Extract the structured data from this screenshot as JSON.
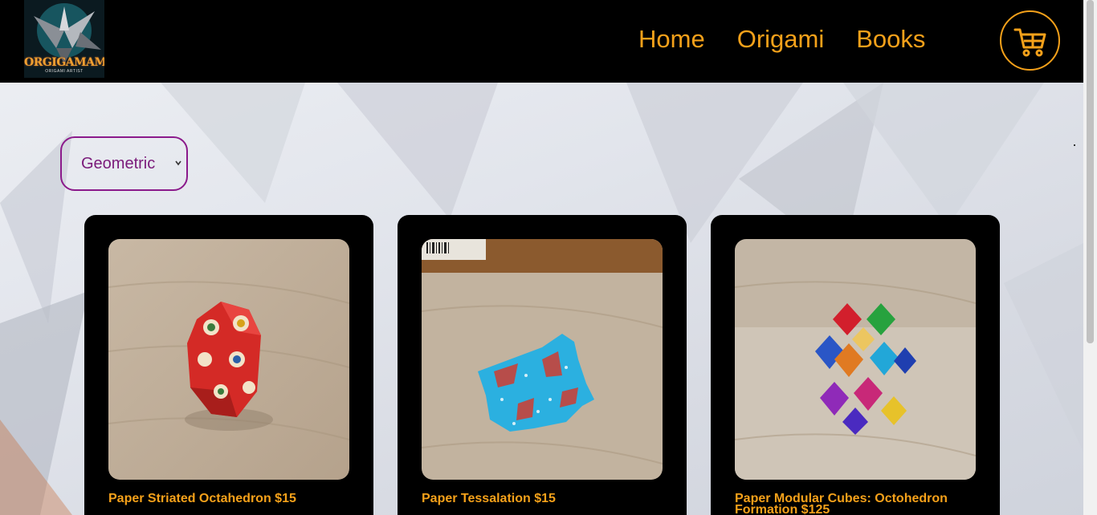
{
  "brand": {
    "logo_text": "ORGIGAMAM",
    "logo_subtext": "ORIGAMI ARTIST"
  },
  "nav": {
    "links": [
      "Home",
      "Origami",
      "Books"
    ],
    "cart_icon": "shopping-cart-icon"
  },
  "filter": {
    "selected": "Geometric"
  },
  "products": [
    {
      "title": "Paper Striated Octahedron $15"
    },
    {
      "title": "Paper Tessalation $15"
    },
    {
      "title": "Paper Modular Cubes: Octohedron Formation $125"
    }
  ],
  "colors": {
    "accent": "#f5a11a",
    "navbar_bg": "#000000",
    "select_border": "#8b1a8b",
    "card_bg": "#000000"
  }
}
